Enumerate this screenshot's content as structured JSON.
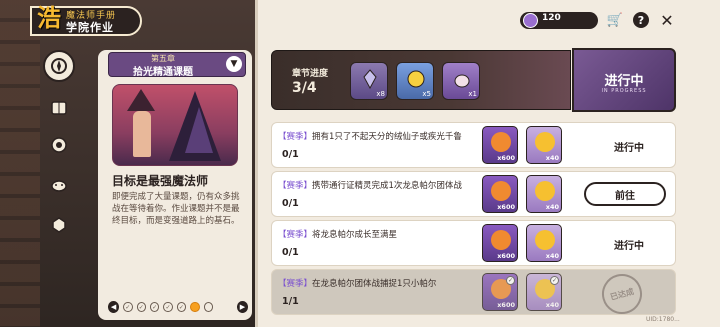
{
  "header": {
    "logo_glyph": "浩",
    "subtitle": "魔法师手册",
    "title": "学院作业"
  },
  "nav": {
    "items": [
      {
        "name": "compass",
        "active": true
      },
      {
        "name": "book",
        "active": false
      },
      {
        "name": "scroll",
        "active": false
      },
      {
        "name": "creature",
        "active": false
      },
      {
        "name": "badge",
        "active": false
      }
    ]
  },
  "chapter": {
    "number": "第五章",
    "name": "拾光精通课题",
    "dropdown_icon": "▼",
    "goal_title": "目标是最强魔法师",
    "goal_desc": "即便完成了大量课题，仍有众多挑战在等待着你。作业课题并不是最终目标，而是变强道路上的基石。"
  },
  "pager": {
    "prev": "◀",
    "next": "▶",
    "dots": [
      "✓",
      "✓",
      "✓",
      "✓",
      "✓",
      "",
      ""
    ]
  },
  "topbar": {
    "currency_value": "120",
    "cart_icon": "🛒",
    "help_icon": "?",
    "close_icon": "✕"
  },
  "progress": {
    "label": "章节进度",
    "value": "3/4",
    "rewards": [
      {
        "count": "x8"
      },
      {
        "count": "x5"
      },
      {
        "count": "x1"
      }
    ],
    "status": "进行中",
    "status_sub": "IN PROGRESS"
  },
  "tasks": [
    {
      "tag": "【赛季】",
      "text": "拥有1只了不起天分的绒仙子或疾光千鲁",
      "progress": "0/1",
      "rewards": [
        {
          "amount": "x600"
        },
        {
          "amount": "x40"
        }
      ],
      "status": "进行中",
      "state": "in_progress"
    },
    {
      "tag": "【赛季】",
      "text": "携带通行证精灵完成1次龙息帕尔团体战",
      "progress": "0/1",
      "rewards": [
        {
          "amount": "x600"
        },
        {
          "amount": "x40"
        }
      ],
      "status": "前往",
      "state": "go"
    },
    {
      "tag": "【赛季】",
      "text": "将龙息帕尔成长至满星",
      "progress": "0/1",
      "rewards": [
        {
          "amount": "x600"
        },
        {
          "amount": "x40"
        }
      ],
      "status": "进行中",
      "state": "in_progress"
    },
    {
      "tag": "【赛季】",
      "text": "在龙息帕尔团体战捕捉1只小帕尔",
      "progress": "1/1",
      "rewards": [
        {
          "amount": "x600"
        },
        {
          "amount": "x40"
        }
      ],
      "status": "已达成",
      "state": "done"
    }
  ],
  "footer": {
    "uid": "UID:1780..."
  },
  "colors": {
    "accent": "#7a4fcf",
    "dark": "#2b2220",
    "panel": "#f2ebe0"
  }
}
